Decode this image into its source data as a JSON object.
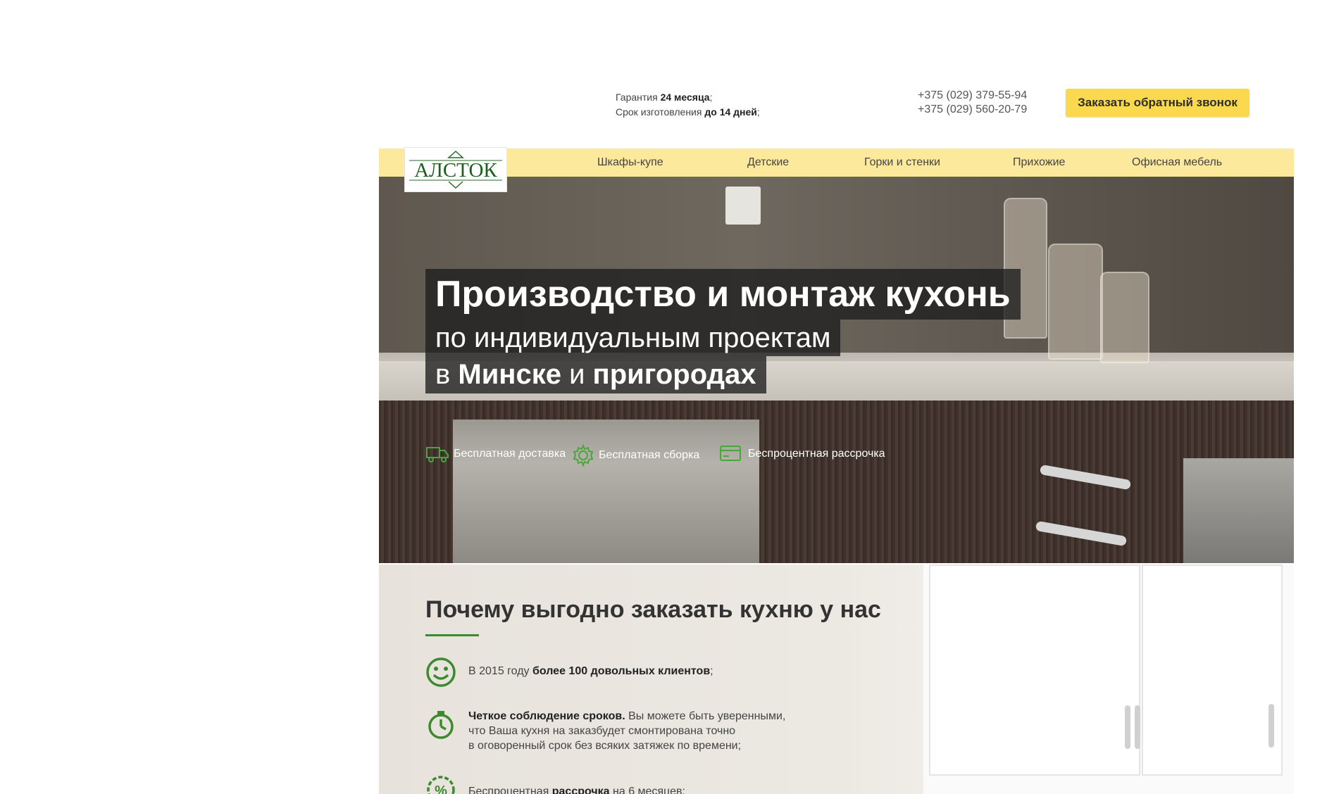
{
  "header": {
    "guarantee_label": "Гарантия",
    "guarantee_value": "24 месяца",
    "guarantee_suffix": ";",
    "production_label": "Срок изготовления",
    "production_value": "до 14 дней",
    "production_suffix": ";",
    "phone1": "+375 (029) 379-55-94",
    "phone2": "+375 (029) 560-20-79",
    "callback_button": "Заказать обратный звонок"
  },
  "logo": {
    "text": "АЛСТОК"
  },
  "nav": {
    "items": [
      {
        "label": "Шкафы-купе"
      },
      {
        "label": "Детские"
      },
      {
        "label": "Горки и стенки"
      },
      {
        "label": "Прихожие"
      },
      {
        "label": "Офисная мебель"
      }
    ]
  },
  "hero": {
    "line1": "Производство и монтаж кухонь",
    "line2": "по индивидуальным проектам",
    "line3_pre": "в ",
    "line3_city": "Минске",
    "line3_mid": " и ",
    "line3_sub": "пригородах",
    "features": [
      {
        "label": "Бесплатная доставка",
        "icon": "truck-icon"
      },
      {
        "label": "Бесплатная сборка",
        "icon": "gear-icon"
      },
      {
        "label": "Беспроцентная рассрочка",
        "icon": "card-icon"
      }
    ]
  },
  "why": {
    "title": "Почему выгодно заказать кухню у нас",
    "item1_pre": "В 2015 году ",
    "item1_bold": "более 100 довольных клиентов",
    "item1_post": ";",
    "item2_bold": "Четкое соблюдение сроков.",
    "item2_line1": " Вы можете быть уверенными,",
    "item2_line2": "что Ваша кухня на заказбудет смонтирована точно",
    "item2_line3": "в оговоренный срок без всяких затяжек по времени;",
    "item3_pre": "Беспроцентная ",
    "item3_bold": "рассрочка",
    "item3_post": " на 6 месяцев;"
  },
  "colors": {
    "accent_yellow": "#fbd94e",
    "nav_bg": "#fde99b",
    "green": "#3c8a2e"
  }
}
